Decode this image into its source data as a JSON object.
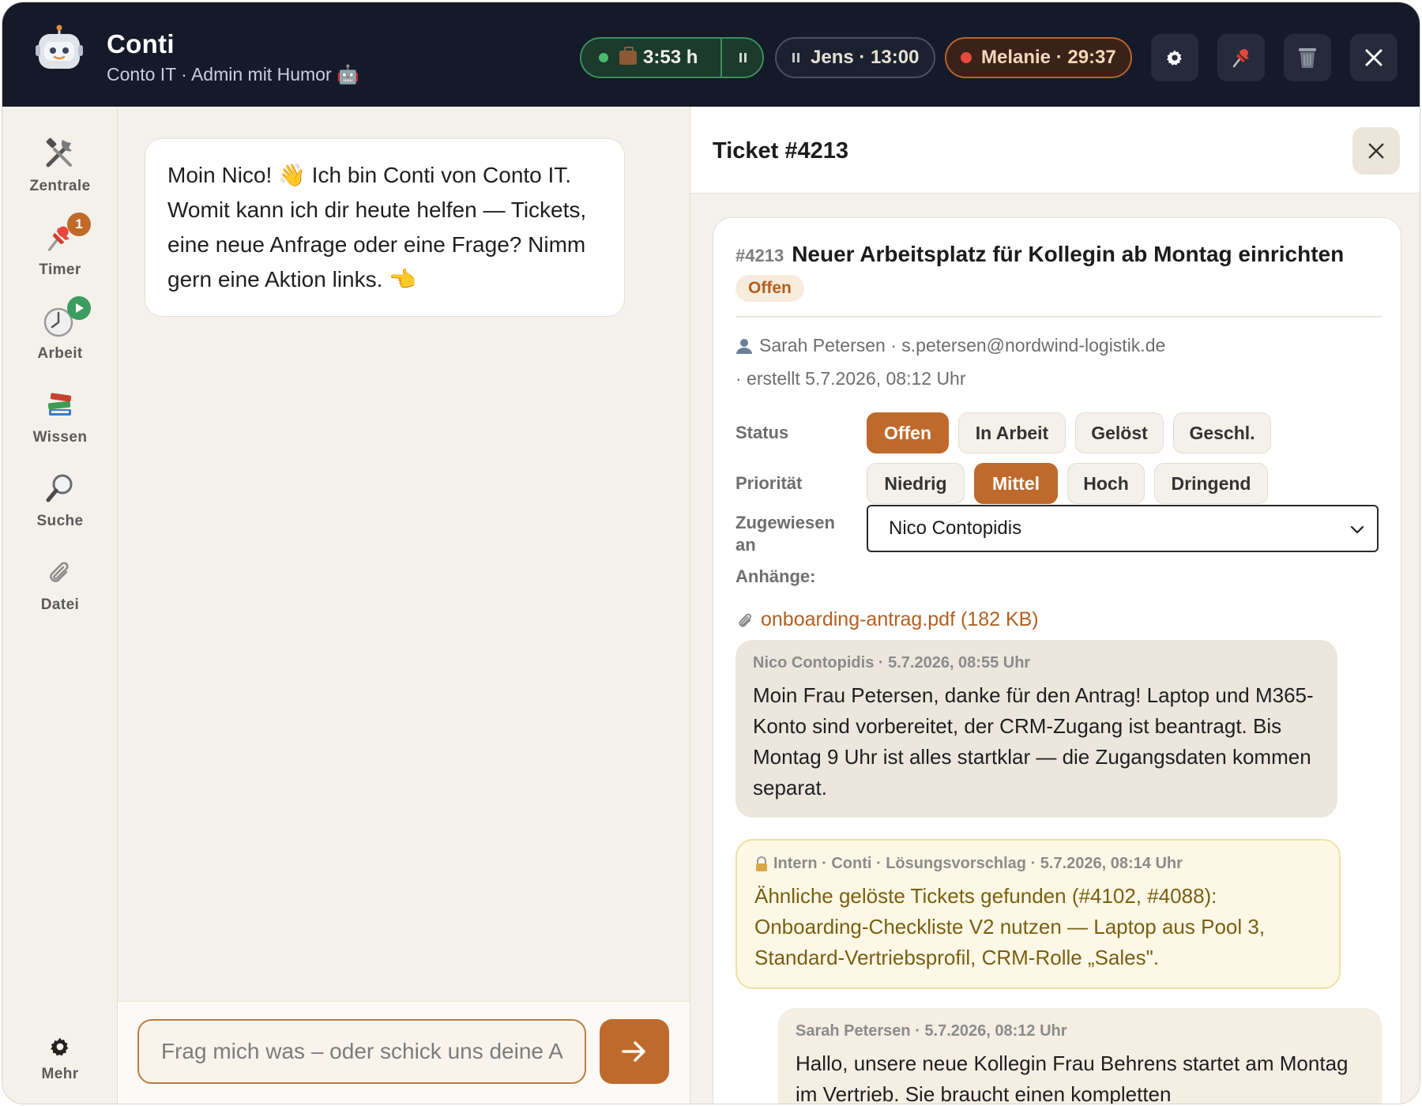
{
  "header": {
    "app_title": "Conti",
    "subtitle": "Conto IT · Admin mit Humor 🤖",
    "work_timer": "3:53 h",
    "jens_timer": "Jens · 13:00",
    "melanie_timer": "Melanie · 29:37"
  },
  "sidebar": {
    "items": [
      {
        "label": "Zentrale",
        "icon": "tools-icon"
      },
      {
        "label": "Timer",
        "icon": "pin-icon",
        "badge": "1"
      },
      {
        "label": "Arbeit",
        "icon": "work-clock-icon"
      },
      {
        "label": "Wissen",
        "icon": "books-icon"
      },
      {
        "label": "Suche",
        "icon": "search-icon"
      },
      {
        "label": "Datei",
        "icon": "paperclip-icon"
      }
    ],
    "more_label": "Mehr"
  },
  "chat": {
    "welcome": "Moin Nico! 👋 Ich bin Conti von Conto IT. Womit kann ich dir heute helfen — Tickets, eine neue Anfrage oder eine Frage? Nimm gern eine Aktion links. 👈",
    "input_placeholder": "Frag mich was – oder schick uns deine Anfrage"
  },
  "ticket": {
    "panel_title": "Ticket #4213",
    "number": "#4213",
    "title": "Neuer Arbeitsplatz für Kollegin ab Montag einrichten",
    "status_badge": "Offen",
    "requester": "Sarah Petersen · s.petersen@nordwind-logistik.de",
    "created": "· erstellt 5.7.2026, 08:12 Uhr",
    "status_label": "Status",
    "status_options": [
      "Offen",
      "In Arbeit",
      "Gelöst",
      "Geschl."
    ],
    "status_selected": "Offen",
    "priority_label": "Priorität",
    "priority_options": [
      "Niedrig",
      "Mittel",
      "Hoch",
      "Dringend"
    ],
    "priority_selected": "Mittel",
    "assigned_label_1": "Zugewiesen",
    "assigned_label_2": "an",
    "assigned_value": "Nico Contopidis",
    "attachments_label": "Anhänge:",
    "attachment": "onboarding-antrag.pdf (182 KB)",
    "messages": [
      {
        "meta": "Nico Contopidis · 5.7.2026, 08:55 Uhr",
        "text": "Moin Frau Petersen, danke für den Antrag! Laptop und M365-Konto sind vorbereitet, der CRM-Zugang ist beantragt. Bis Montag 9 Uhr ist alles startklar — die Zugangsdaten kommen separat."
      },
      {
        "meta": "Intern · Conti · Lösungsvorschlag · 5.7.2026, 08:14 Uhr",
        "text": "Ähnliche gelöste Tickets gefunden (#4102, #4088): Onboarding-Checkliste V2 nutzen — Laptop aus Pool 3, Standard-Vertriebsprofil, CRM-Rolle „Sales\"."
      },
      {
        "meta": "Sarah Petersen · 5.7.2026, 08:12 Uhr",
        "text": "Hallo, unsere neue Kollegin Frau Behrens startet am Montag im Vertrieb. Sie braucht einen kompletten"
      }
    ]
  },
  "colors": {
    "accent": "#bf6a2c",
    "header_bg": "#141a29",
    "app_bg": "#f4f1ea",
    "internal_note_bg": "#fdf8e6"
  }
}
